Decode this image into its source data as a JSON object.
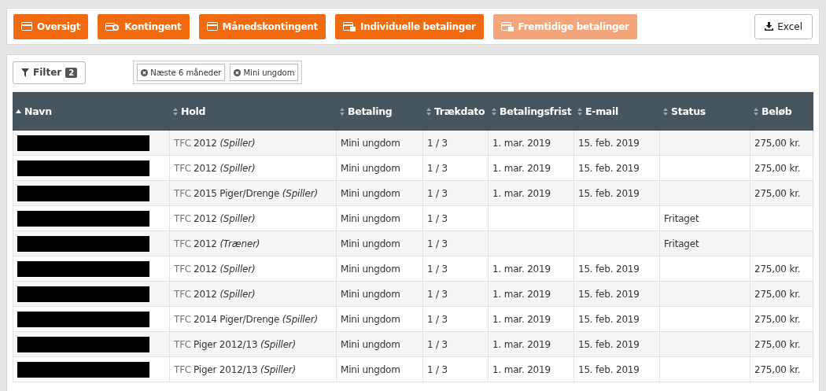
{
  "toolbar": {
    "tabs": [
      {
        "label": "Oversigt",
        "kind": "card",
        "selected": false
      },
      {
        "label": "Kontingent",
        "kind": "coin",
        "selected": false
      },
      {
        "label": "Månedskontingent",
        "kind": "card",
        "selected": false
      },
      {
        "label": "Individuelle betalinger",
        "kind": "list",
        "selected": false
      },
      {
        "label": "Fremtidige betalinger",
        "kind": "list",
        "selected": true
      }
    ],
    "export_button": "Excel"
  },
  "filter": {
    "label": "Filter",
    "count": "2",
    "chips": [
      "Næste 6 måneder",
      "Mini ungdom"
    ]
  },
  "table": {
    "columns": [
      {
        "label": "Navn",
        "sorted": true
      },
      {
        "label": "Hold",
        "sorted": false
      },
      {
        "label": "Betaling",
        "sorted": false
      },
      {
        "label": "Trækdato",
        "sorted": false
      },
      {
        "label": "Betalingsfrist",
        "sorted": false
      },
      {
        "label": "E-mail",
        "sorted": false
      },
      {
        "label": "Status",
        "sorted": false
      },
      {
        "label": "Beløb",
        "sorted": false
      }
    ],
    "rows": [
      {
        "club": "TFC",
        "team": "2012",
        "role": "(Spiller)",
        "payment": "Mini ungdom",
        "draw": "1 / 3",
        "due": "1. mar. 2019",
        "email": "15. feb. 2019",
        "status": "",
        "amount": "275,00 kr."
      },
      {
        "club": "TFC",
        "team": "2012",
        "role": "(Spiller)",
        "payment": "Mini ungdom",
        "draw": "1 / 3",
        "due": "1. mar. 2019",
        "email": "15. feb. 2019",
        "status": "",
        "amount": "275,00 kr."
      },
      {
        "club": "TFC",
        "team": "2015 Piger/Drenge",
        "role": "(Spiller)",
        "payment": "Mini ungdom",
        "draw": "1 / 3",
        "due": "1. mar. 2019",
        "email": "15. feb. 2019",
        "status": "",
        "amount": "275,00 kr."
      },
      {
        "club": "TFC",
        "team": "2012",
        "role": "(Spiller)",
        "payment": "Mini ungdom",
        "draw": "1 / 3",
        "due": "",
        "email": "",
        "status": "Fritaget",
        "amount": ""
      },
      {
        "club": "TFC",
        "team": "2012",
        "role": "(Træner)",
        "payment": "Mini ungdom",
        "draw": "1 / 3",
        "due": "",
        "email": "",
        "status": "Fritaget",
        "amount": ""
      },
      {
        "club": "TFC",
        "team": "2012",
        "role": "(Spiller)",
        "payment": "Mini ungdom",
        "draw": "1 / 3",
        "due": "1. mar. 2019",
        "email": "15. feb. 2019",
        "status": "",
        "amount": "275,00 kr."
      },
      {
        "club": "TFC",
        "team": "2012",
        "role": "(Spiller)",
        "payment": "Mini ungdom",
        "draw": "1 / 3",
        "due": "1. mar. 2019",
        "email": "15. feb. 2019",
        "status": "",
        "amount": "275,00 kr."
      },
      {
        "club": "TFC",
        "team": "2014 Piger/Drenge",
        "role": "(Spiller)",
        "payment": "Mini ungdom",
        "draw": "1 / 3",
        "due": "1. mar. 2019",
        "email": "15. feb. 2019",
        "status": "",
        "amount": "275,00 kr."
      },
      {
        "club": "TFC",
        "team": "Piger 2012/13",
        "role": "(Spiller)",
        "payment": "Mini ungdom",
        "draw": "1 / 3",
        "due": "1. mar. 2019",
        "email": "15. feb. 2019",
        "status": "",
        "amount": "275,00 kr."
      },
      {
        "club": "TFC",
        "team": "Piger 2012/13",
        "role": "(Spiller)",
        "payment": "Mini ungdom",
        "draw": "1 / 3",
        "due": "1. mar. 2019",
        "email": "15. feb. 2019",
        "status": "",
        "amount": "275,00 kr."
      }
    ]
  }
}
